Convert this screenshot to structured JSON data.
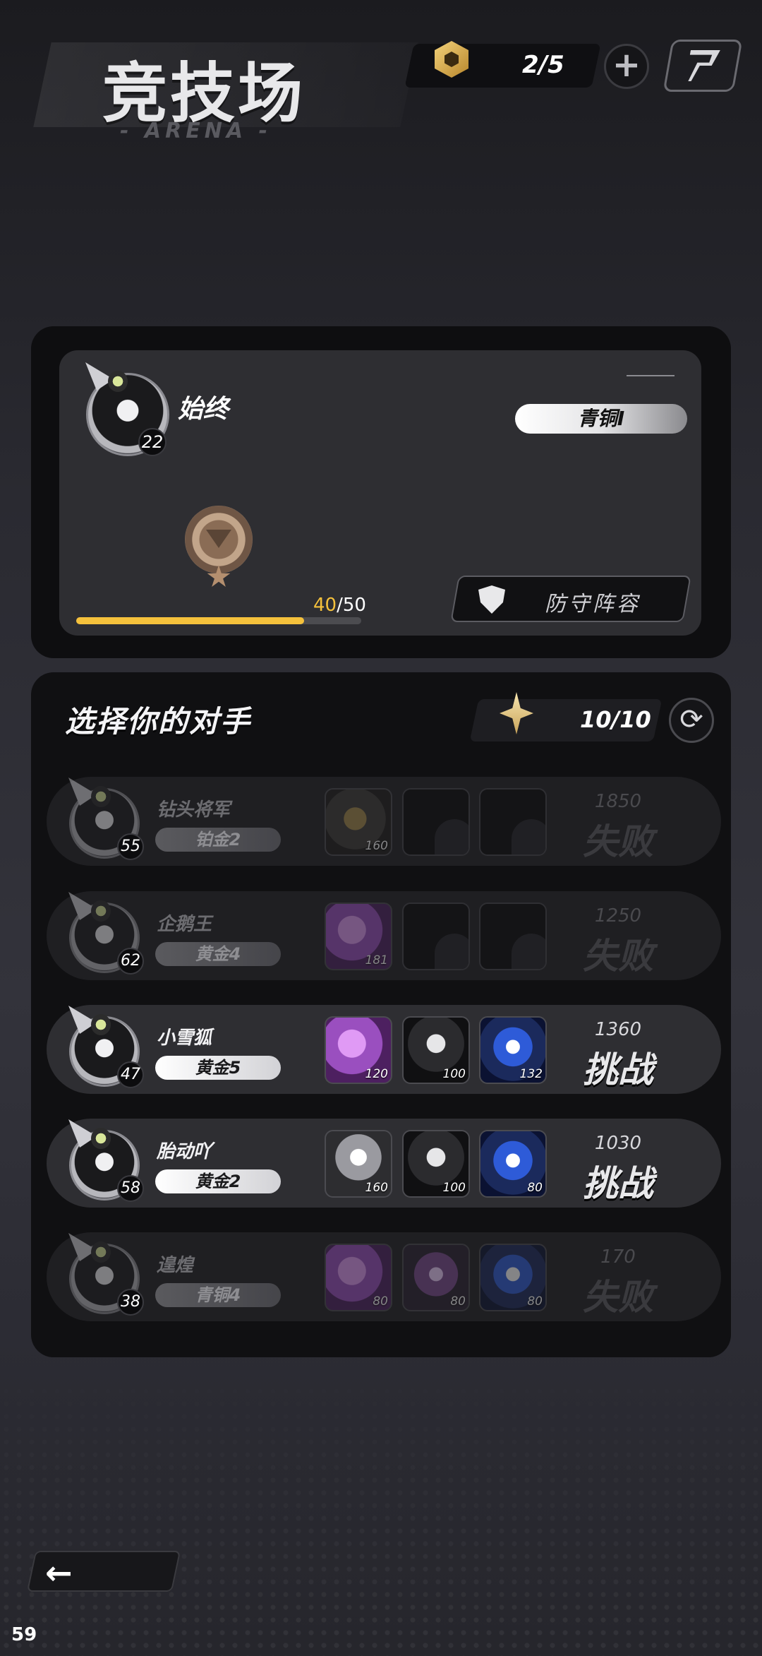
{
  "header": {
    "title": "竞技场",
    "subtitle": "- ARENA -",
    "ticket_count": "2/5",
    "plus_label": "+"
  },
  "profile": {
    "name": "始终",
    "level": "22",
    "rank": "青铜I",
    "progress_current": "40",
    "progress_total": "/50",
    "progress_fraction": 0.8,
    "defense_label": "防守阵容"
  },
  "opponents_section": {
    "title": "选择你的对手",
    "challenge_count": "10/10",
    "refresh_icon": "refresh-icon"
  },
  "opponents": [
    {
      "name": "钻头将军",
      "level": "55",
      "rank": "铂金2",
      "score": "1850",
      "action": "失败",
      "active": false,
      "heroes": [
        {
          "style": "h-gold",
          "level": "160"
        },
        {
          "style": "empty",
          "level": ""
        },
        {
          "style": "empty",
          "level": ""
        }
      ]
    },
    {
      "name": "企鹅王",
      "level": "62",
      "rank": "黄金4",
      "score": "1250",
      "action": "失败",
      "active": false,
      "heroes": [
        {
          "style": "h-purple",
          "level": "181"
        },
        {
          "style": "empty",
          "level": ""
        },
        {
          "style": "empty",
          "level": ""
        }
      ]
    },
    {
      "name": "小雪狐",
      "level": "47",
      "rank": "黄金5",
      "score": "1360",
      "action": "挑战",
      "active": true,
      "heroes": [
        {
          "style": "h-purple",
          "level": "120"
        },
        {
          "style": "h-dark",
          "level": "100"
        },
        {
          "style": "h-blue",
          "level": "132"
        }
      ]
    },
    {
      "name": "胎动吖",
      "level": "58",
      "rank": "黄金2",
      "score": "1030",
      "action": "挑战",
      "active": true,
      "heroes": [
        {
          "style": "h-grey",
          "level": "160"
        },
        {
          "style": "h-dark",
          "level": "100"
        },
        {
          "style": "h-blue",
          "level": "80"
        }
      ]
    },
    {
      "name": "遑煌",
      "level": "38",
      "rank": "青铜4",
      "score": "170",
      "action": "失败",
      "active": false,
      "heroes": [
        {
          "style": "h-purple",
          "level": "80"
        },
        {
          "style": "h-violet",
          "level": "80"
        },
        {
          "style": "h-blue",
          "level": "80"
        }
      ]
    }
  ],
  "footer": {
    "back_label": "←",
    "fps": "59"
  },
  "colors": {
    "accent_gold": "#f5c13c",
    "panel_dark": "#101012"
  }
}
